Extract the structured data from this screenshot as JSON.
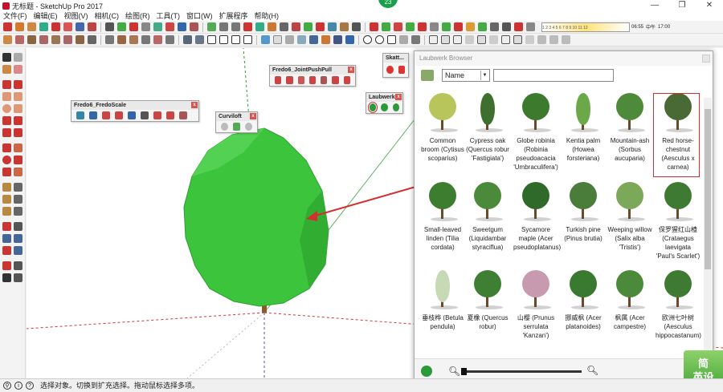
{
  "window": {
    "title": "无标题 - SketchUp Pro 2017",
    "badge": "23",
    "controls": [
      "—",
      "❐",
      "✕"
    ]
  },
  "menu": [
    "文件(F)",
    "编辑(E)",
    "视图(V)",
    "相机(C)",
    "绘图(R)",
    "工具(T)",
    "窗口(W)",
    "扩展程序",
    "帮助(H)"
  ],
  "scale_bar": {
    "ticks": "1 2 3 4 5 6 7 8 9 10 11 12",
    "time_left": "06:55",
    "time_mid": "中午",
    "time_right": "17:00"
  },
  "floating_toolbars": {
    "fredo_scale": "Fredo6_FredoScale",
    "curviloft": "Curviloft",
    "joint_push_pull": "Fredo6_JointPushPull",
    "skatter": "Skatt...",
    "laubwerk": "Laubwerk",
    "close": "x"
  },
  "browser": {
    "title": "Laubwerk Browser",
    "sort_value": "Name",
    "search_value": "",
    "items": [
      {
        "label": "Common broom (Cytisus scoparius)"
      },
      {
        "label": "Cypress oak (Quercus robur 'Fastigiata')"
      },
      {
        "label": "Globe robinia (Robinia pseudoacacia 'Umbraculifera')"
      },
      {
        "label": "Kentia palm (Howea forsteriana)"
      },
      {
        "label": "Mountain-ash (Sorbus aucuparia)"
      },
      {
        "label": "Red horse-chestnut (Aesculus x carnea)"
      },
      {
        "label": "Small-leaved linden (Tilia cordata)"
      },
      {
        "label": "Sweetgum (Liquidambar styraciflua)"
      },
      {
        "label": "Sycamore maple (Acer pseudoplatanus)"
      },
      {
        "label": "Turkish pine (Pinus brutia)"
      },
      {
        "label": "Weeping willow (Salix alba 'Tristis')"
      },
      {
        "label": "保罗猩红山楂 (Crataegus laevigata 'Paul's Scarlet')"
      },
      {
        "label": "垂枝桦 (Betula pendula)"
      },
      {
        "label": "夏橡 (Quercus robur)"
      },
      {
        "label": "山樱 (Prunus serrulata 'Kanzan')"
      },
      {
        "label": "挪威枫 (Acer platanoides)"
      },
      {
        "label": "枫属 (Acer campestre)"
      },
      {
        "label": "欧洲七叶树 (Aesculus hippocastanum)"
      }
    ]
  },
  "status": {
    "text": "选择对象。切换到扩充选择。拖动鼠标选择多项。"
  },
  "ime": {
    "line1": "简",
    "line2": "英设"
  },
  "colors": {
    "tree_green": "#3cc43c",
    "selection_red": "#d32f2f",
    "badge_green": "#1aa04a"
  }
}
